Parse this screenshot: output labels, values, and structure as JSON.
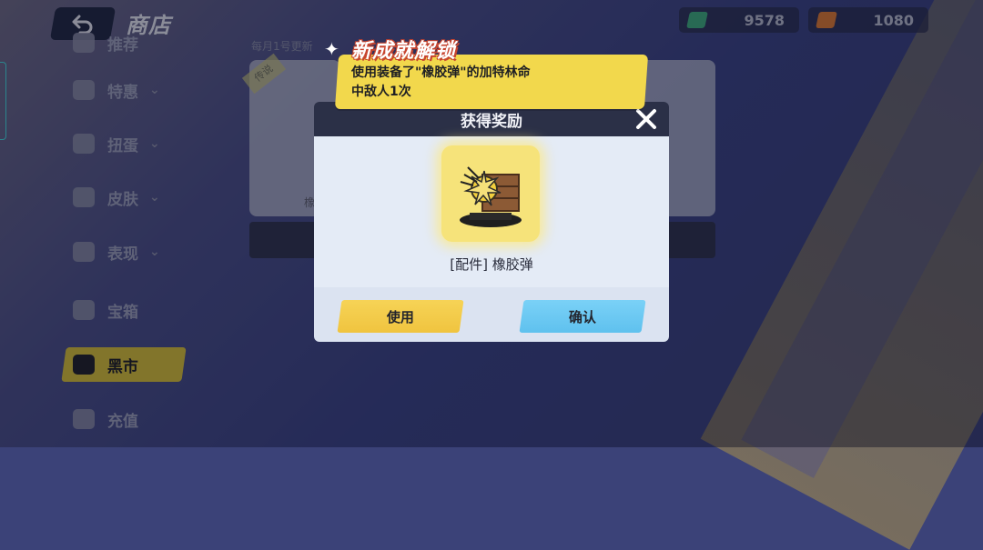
{
  "header": {
    "title": "商店",
    "back_icon": "back-arrow-icon"
  },
  "currencies": [
    {
      "icon": "ticket-icon",
      "color": "#3fae7a",
      "value": "9578"
    },
    {
      "icon": "coin-icon",
      "color": "#e07a2f",
      "value": "1080"
    }
  ],
  "sidebar": {
    "items": [
      {
        "label": "推荐",
        "icon": "recommend-icon",
        "has_chevron": false
      },
      {
        "label": "特惠",
        "icon": "gift-icon",
        "has_chevron": true
      },
      {
        "label": "扭蛋",
        "icon": "gacha-icon",
        "has_chevron": true
      },
      {
        "label": "皮肤",
        "icon": "shirt-icon",
        "has_chevron": true
      },
      {
        "label": "表现",
        "icon": "effect-icon",
        "has_chevron": true
      },
      {
        "label": "宝箱",
        "icon": "chest-icon",
        "has_chevron": false
      },
      {
        "label": "黑市",
        "icon": "cat-icon",
        "has_chevron": false,
        "active": true
      },
      {
        "label": "充值",
        "icon": "gem-icon",
        "has_chevron": false
      }
    ]
  },
  "shop": {
    "refresh_note": "每月1号更新",
    "tag_label": "传说",
    "card_label_partial": "橡"
  },
  "achievement": {
    "title": "新成就解锁",
    "description_line1": "使用装备了\"橡胶弹\"的加特林命",
    "description_line2": "中敌人1次"
  },
  "dialog": {
    "title": "获得奖励",
    "item_name": "[配件] 橡胶弹",
    "use_label": "使用",
    "confirm_label": "确认"
  }
}
